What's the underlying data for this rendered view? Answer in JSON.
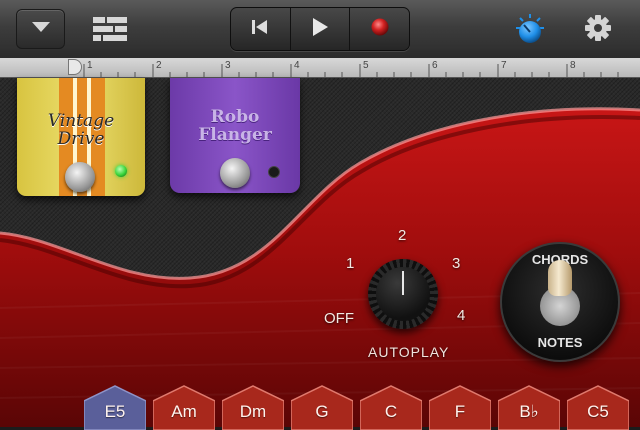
{
  "toolbar": {
    "menu_icon": "chevron-down-icon",
    "tracks_icon": "tracks-view-icon",
    "rewind_icon": "skip-back-icon",
    "play_icon": "play-icon",
    "record_icon": "record-icon",
    "master_knob_icon": "master-effects-knob-icon",
    "settings_icon": "gear-icon",
    "record_color": "#d32222",
    "accent_color": "#1f8fe8"
  },
  "ruler": {
    "bars": [
      "1",
      "2",
      "3",
      "4",
      "5",
      "6",
      "7",
      "8"
    ]
  },
  "pedals": [
    {
      "name_line1": "Vintage",
      "name_line2": "Drive",
      "color": "#e5d35c",
      "led_color": "#38d43a"
    },
    {
      "name_line1": "Robo",
      "name_line2": "Flanger",
      "color": "#7a45b8"
    }
  ],
  "autoplay": {
    "label": "AUTOPLAY",
    "positions": [
      "OFF",
      "1",
      "2",
      "3",
      "4"
    ],
    "selected": "2"
  },
  "mode_switch": {
    "top_label": "CHORDS",
    "bottom_label": "NOTES",
    "selected": "CHORDS"
  },
  "chords": {
    "items": [
      "E5",
      "Am",
      "Dm",
      "G",
      "C",
      "F",
      "B♭",
      "C5"
    ],
    "selected": "E5"
  }
}
